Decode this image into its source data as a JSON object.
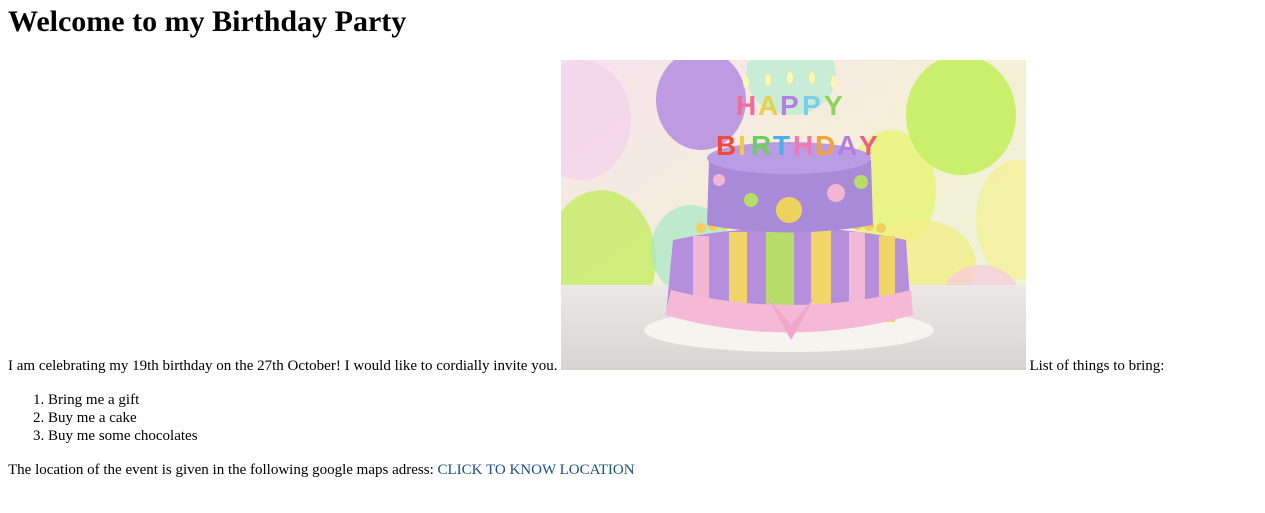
{
  "page": {
    "title": "Welcome to my Birthday Party",
    "intro_text": "I am celebrating my 19th birthday on the 27th October! I would like to cordially invite you.",
    "bring_heading": "List of things to bring:",
    "items": [
      "Bring me a gift",
      "Buy me a cake",
      "Buy me some chocolates"
    ],
    "location_text": "The location of the event is given in the following google maps adress:",
    "location_link_label": "CLICK TO KNOW LOCATION"
  },
  "image": {
    "subject": "birthday-cake-photo",
    "candle_letters": [
      "HAPPY",
      "BIRTHDAY"
    ]
  },
  "colors": {
    "link": "#1a4f8a"
  }
}
